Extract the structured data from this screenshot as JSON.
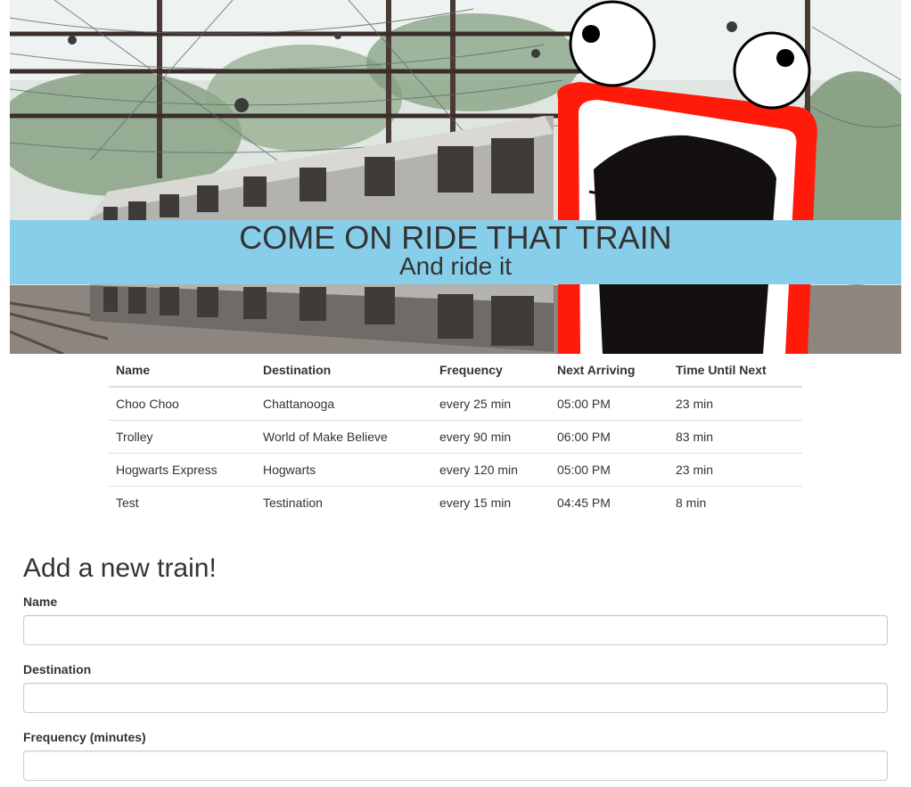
{
  "hero": {
    "title": "COME ON RIDE THAT TRAIN",
    "subtitle": "And ride it",
    "band_color": "#87ceeb",
    "image_description_icon": "train-photo-with-screaming-cartoon-face"
  },
  "schedule": {
    "columns": [
      "Name",
      "Destination",
      "Frequency",
      "Next Arriving",
      "Time Until Next"
    ],
    "rows": [
      [
        "Choo Choo",
        "Chattanooga",
        "every 25 min",
        "05:00 PM",
        "23 min"
      ],
      [
        "Trolley",
        "World of Make Believe",
        "every 90 min",
        "06:00 PM",
        "83 min"
      ],
      [
        "Hogwarts Express",
        "Hogwarts",
        "every 120 min",
        "05:00 PM",
        "23 min"
      ],
      [
        "Test",
        "Testination",
        "every 15 min",
        "04:45 PM",
        "8 min"
      ]
    ]
  },
  "form": {
    "heading": "Add a new train!",
    "fields": [
      {
        "label": "Name",
        "value": "",
        "placeholder": ""
      },
      {
        "label": "Destination",
        "value": "",
        "placeholder": ""
      },
      {
        "label": "Frequency (minutes)",
        "value": "",
        "placeholder": ""
      }
    ]
  }
}
